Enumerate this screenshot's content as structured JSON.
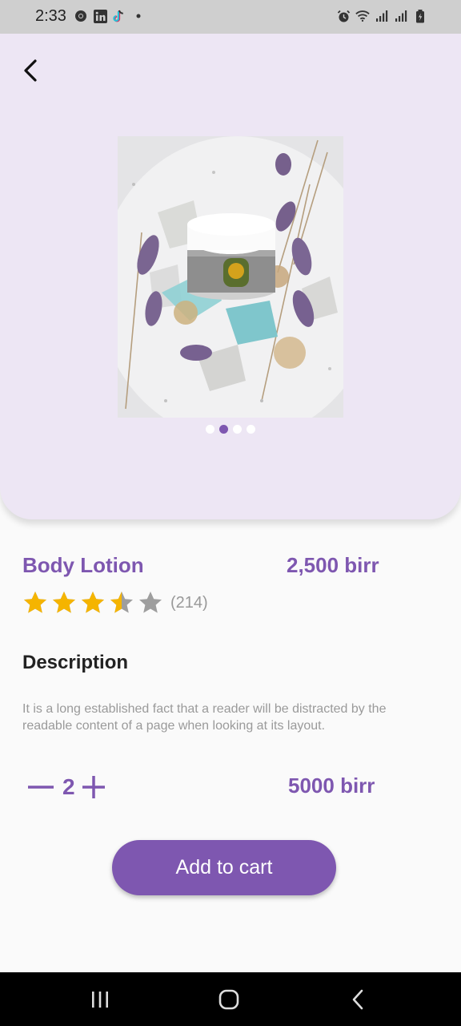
{
  "status_bar": {
    "time": "2:33",
    "left_icons": [
      "chrome-icon",
      "linkedin-icon",
      "tiktok-icon",
      "dot-icon"
    ],
    "right_icons": [
      "alarm-icon",
      "wifi-icon",
      "signal-icon",
      "signal-icon",
      "battery-icon"
    ]
  },
  "product": {
    "name": "Body Lotion",
    "price": "2,500 birr",
    "rating": 3.5,
    "rating_max": 5,
    "rating_count": "(214)",
    "image_icon": "body-lotion-jar-photo",
    "carousel": {
      "total": 4,
      "active_index": 1
    }
  },
  "description": {
    "heading": "Description",
    "text": "It is a long established fact that a reader will be distracted by the readable content of a page when looking at its layout."
  },
  "quantity": {
    "value": "2",
    "decrement_icon": "minus-icon",
    "increment_icon": "plus-icon",
    "total": "5000 birr"
  },
  "cta": {
    "add_to_cart_label": "Add to cart"
  },
  "colors": {
    "accent": "#7e57b0",
    "hero_bg": "#ede6f4",
    "star": "#f5b400",
    "star_empty": "#9e9e9e"
  }
}
